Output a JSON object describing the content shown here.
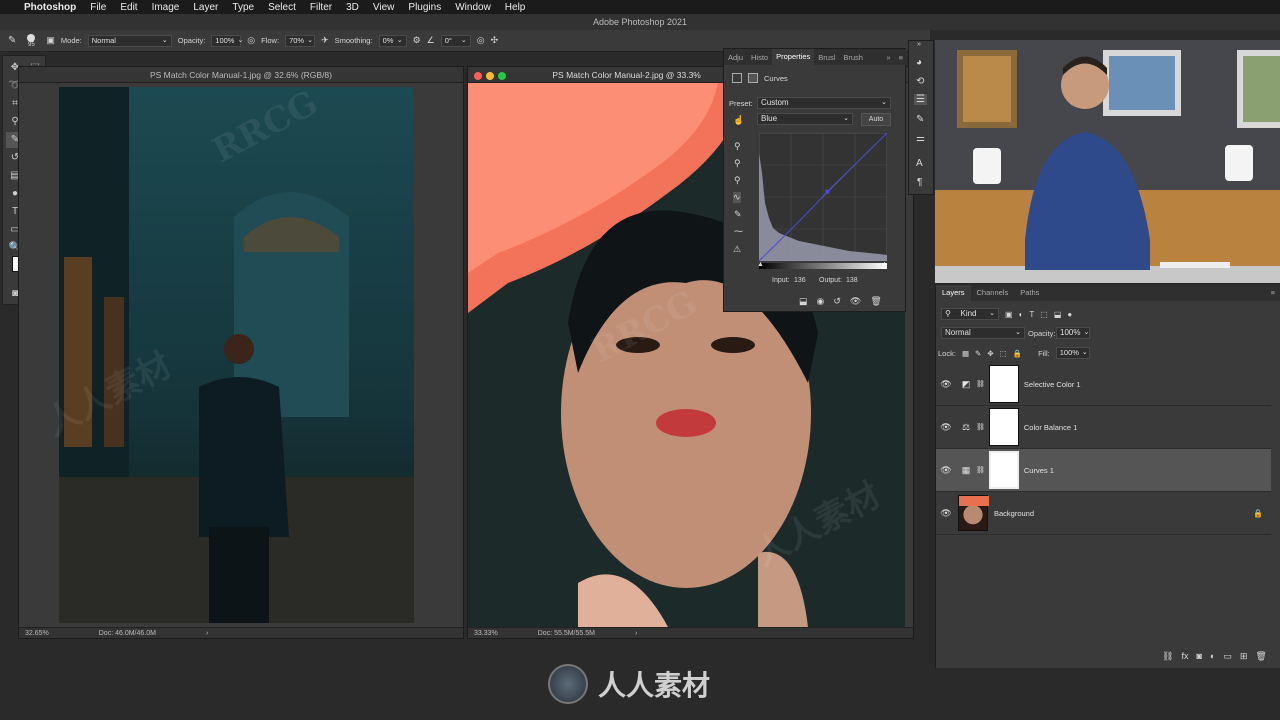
{
  "menubar": {
    "apple": "",
    "app_name": "Photoshop",
    "items": [
      "File",
      "Edit",
      "Image",
      "Layer",
      "Type",
      "Select",
      "Filter",
      "3D",
      "View",
      "Plugins",
      "Window",
      "Help"
    ]
  },
  "window_title": "Adobe Photoshop 2021",
  "options_bar": {
    "brush_size": "95",
    "mode_label": "Mode:",
    "mode_value": "Normal",
    "opacity_label": "Opacity:",
    "opacity_value": "100%",
    "flow_label": "Flow:",
    "flow_value": "70%",
    "smoothing_label": "Smoothing:",
    "smoothing_value": "0%",
    "angle_value": "0°"
  },
  "doc1": {
    "title": "PS Match Color Manual-1.jpg @ 32.6% (RGB/8)",
    "zoom": "32.65%",
    "doc_size": "Doc: 46.0M/46.0M"
  },
  "doc2": {
    "title": "PS Match Color Manual-2.jpg @ 33.3%",
    "zoom": "33.33%",
    "doc_size": "Doc: 55.5M/55.5M"
  },
  "properties": {
    "tabs": [
      "Adju",
      "Histo",
      "Properties",
      "Brusl",
      "Brush"
    ],
    "active_tab": "Properties",
    "panel_title": "Curves",
    "preset_label": "Preset:",
    "preset_value": "Custom",
    "channel_value": "Blue",
    "auto_label": "Auto",
    "input_label": "Input:",
    "input_value": "136",
    "output_label": "Output:",
    "output_value": "138",
    "curve_point": {
      "input": 136,
      "output": 138
    }
  },
  "layers_panel": {
    "tabs": [
      "Layers",
      "Channels",
      "Paths"
    ],
    "active_tab": "Layers",
    "filter_label": "Kind",
    "blend_mode": "Normal",
    "opacity_label": "Opacity:",
    "opacity_value": "100%",
    "lock_label": "Lock:",
    "fill_label": "Fill:",
    "fill_value": "100%",
    "layers": [
      {
        "name": "Selective Color 1",
        "icon": "selective-color-icon",
        "selected": false
      },
      {
        "name": "Color Balance 1",
        "icon": "color-balance-icon",
        "selected": false
      },
      {
        "name": "Curves 1",
        "icon": "curves-icon",
        "selected": true
      },
      {
        "name": "Background",
        "icon": "image-thumbnail",
        "selected": false,
        "locked": true
      }
    ]
  },
  "watermark": {
    "logo_text": "人人素材",
    "tile_text": "RRCG",
    "tile_text_cn": "人人素材"
  },
  "colors": {
    "panel_bg": "#3a3a3a",
    "menubar_bg": "#1b1b1b",
    "selected_layer": "#555555",
    "curve_line": "#4a4ad6"
  }
}
